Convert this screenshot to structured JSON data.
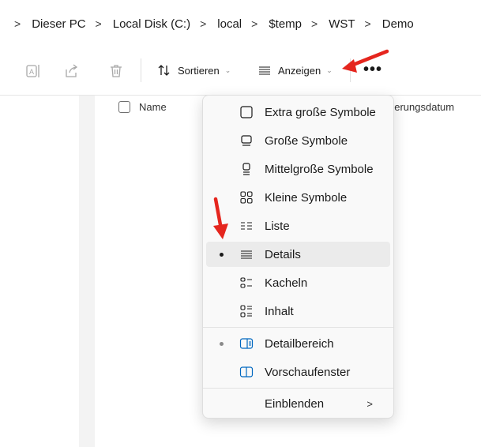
{
  "breadcrumb": {
    "items": [
      "Dieser PC",
      "Local Disk (C:)",
      "local",
      "$temp",
      "WST",
      "Demo"
    ],
    "separator": ">"
  },
  "toolbar": {
    "rename_icon": "rename-icon",
    "share_icon": "share-icon",
    "delete_icon": "delete-icon",
    "sort_label": "Sortieren",
    "view_label": "Anzeigen",
    "more_label": "•••"
  },
  "columns": {
    "name": "Name",
    "date_partial": "derungsdatum"
  },
  "view_menu": {
    "items": [
      {
        "label": "Extra große Symbole",
        "icon": "extra-large-icons-icon",
        "selected": false
      },
      {
        "label": "Große Symbole",
        "icon": "large-icons-icon",
        "selected": false
      },
      {
        "label": "Mittelgroße Symbole",
        "icon": "medium-icons-icon",
        "selected": false
      },
      {
        "label": "Kleine Symbole",
        "icon": "small-icons-icon",
        "selected": false
      },
      {
        "label": "Liste",
        "icon": "list-icon",
        "selected": false
      },
      {
        "label": "Details",
        "icon": "details-icon",
        "selected": true
      },
      {
        "label": "Kacheln",
        "icon": "tiles-icon",
        "selected": false
      },
      {
        "label": "Inhalt",
        "icon": "content-icon",
        "selected": false
      }
    ],
    "panes": [
      {
        "label": "Detailbereich",
        "icon": "details-pane-icon",
        "active": true
      },
      {
        "label": "Vorschaufenster",
        "icon": "preview-pane-icon",
        "active": false
      }
    ],
    "show_label": "Einblenden",
    "show_chevron": ">"
  },
  "colors": {
    "accent": "#0067c0",
    "annotation_arrow": "#e5261e",
    "selection_bg": "#ebebeb"
  }
}
